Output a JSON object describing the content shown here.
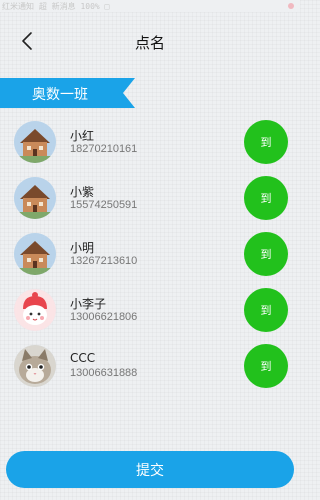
{
  "status_bar": {
    "text": "红米通知 超 新消息 100% □"
  },
  "header": {
    "title": "点名",
    "back_icon": "chevron-left-icon"
  },
  "class_tab": {
    "label": "奥数一班"
  },
  "students": [
    {
      "name": "小红",
      "phone": "18270210161",
      "button": "到",
      "avatar": "house-avatar"
    },
    {
      "name": "小紫",
      "phone": "15574250591",
      "button": "到",
      "avatar": "house-avatar"
    },
    {
      "name": "小明",
      "phone": "13267213610",
      "button": "到",
      "avatar": "house-avatar"
    },
    {
      "name": "小李子",
      "phone": "13006621806",
      "button": "到",
      "avatar": "cartoon-avatar"
    },
    {
      "name": "CCC",
      "phone": "13006631888",
      "button": "到",
      "avatar": "cat-avatar"
    }
  ],
  "footer": {
    "submit_label": "提交"
  },
  "colors": {
    "accent_blue": "#1aa3e8",
    "present_green": "#22c11c",
    "background": "#eef0f2"
  }
}
